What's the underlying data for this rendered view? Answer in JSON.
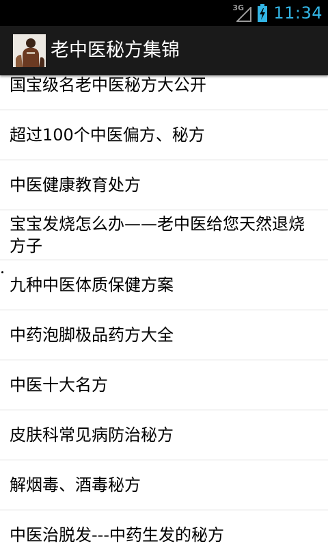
{
  "status_bar": {
    "network_type": "3G",
    "time": "11:34",
    "clock_color": "#33b5e5"
  },
  "action_bar": {
    "title": "老中医秘方集锦",
    "background": "#1a1a1a"
  },
  "list": {
    "items": [
      "国宝级名老中医秘方大公开",
      "超过100个中医偏方、秘方",
      "中医健康教育处方",
      "宝宝发烧怎么办——老中医给您天然退烧方子",
      "九种中医体质保健方案",
      "中药泡脚极品药方大全",
      "中医十大名方",
      "皮肤科常见病防治秘方",
      "解烟毒、酒毒秘方",
      "中医治脱发---中药生发的秘方"
    ]
  }
}
